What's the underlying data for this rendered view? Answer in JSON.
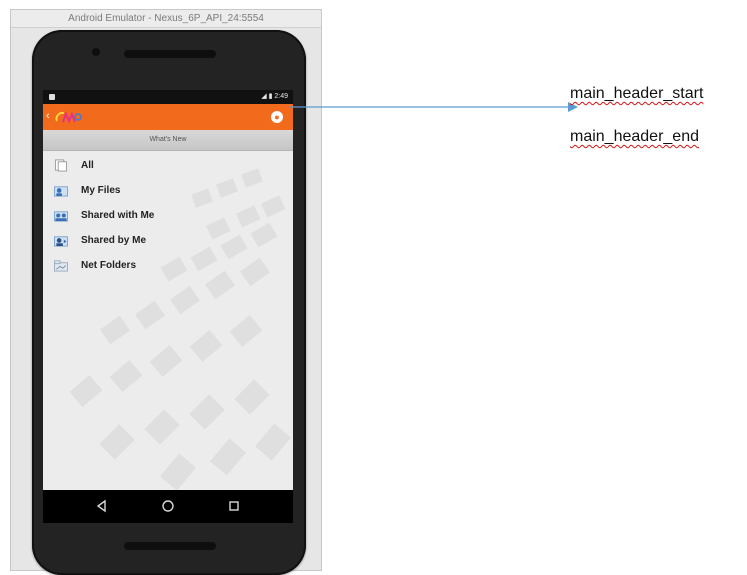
{
  "window": {
    "title": "Android Emulator - Nexus_6P_API_24:5554"
  },
  "status_bar": {
    "time": "2:49"
  },
  "app": {
    "accent": "#f26a1b",
    "whats_new": "What's New",
    "account_icon": "account-icon"
  },
  "nav_items": [
    {
      "label": "All",
      "icon": "all-files-icon"
    },
    {
      "label": "My Files",
      "icon": "my-files-icon"
    },
    {
      "label": "Shared with Me",
      "icon": "shared-with-me-icon"
    },
    {
      "label": "Shared by Me",
      "icon": "shared-by-me-icon"
    },
    {
      "label": "Net Folders",
      "icon": "net-folders-icon"
    }
  ],
  "annotations": {
    "start": "main_header_start",
    "end": "main_header_end",
    "arrow_color": "#5b9bd5"
  }
}
